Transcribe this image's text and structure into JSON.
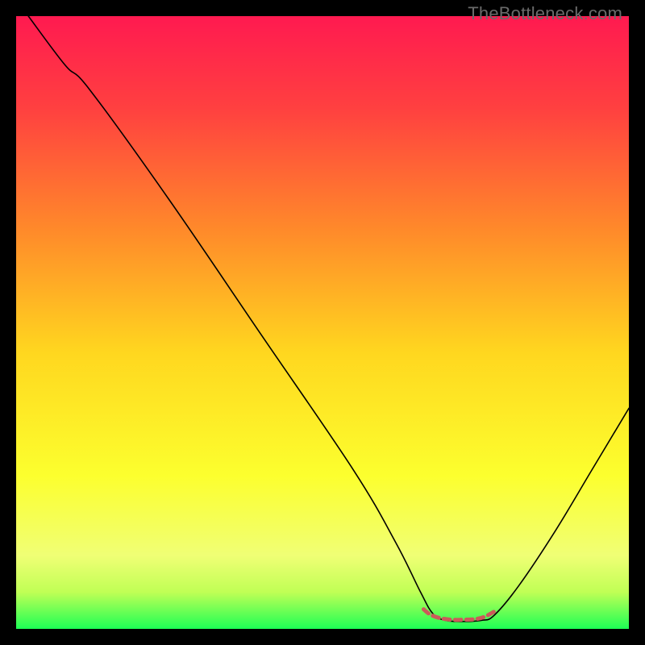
{
  "watermark": "TheBottleneck.com",
  "chart_data": {
    "type": "line",
    "title": "",
    "xlabel": "",
    "ylabel": "",
    "xlim": [
      0,
      100
    ],
    "ylim": [
      0,
      100
    ],
    "gradient_stops": [
      {
        "offset": 0.0,
        "color": "#ff1a50"
      },
      {
        "offset": 0.15,
        "color": "#ff4040"
      },
      {
        "offset": 0.35,
        "color": "#ff8a2a"
      },
      {
        "offset": 0.55,
        "color": "#ffd71f"
      },
      {
        "offset": 0.75,
        "color": "#fcff2e"
      },
      {
        "offset": 0.88,
        "color": "#f0ff75"
      },
      {
        "offset": 0.94,
        "color": "#c0ff55"
      },
      {
        "offset": 1.0,
        "color": "#1dff55"
      }
    ],
    "series": [
      {
        "name": "bottleneck-curve",
        "stroke": "#000000",
        "stroke_width": 1.6,
        "points": [
          {
            "x": 2.0,
            "y": 100.0
          },
          {
            "x": 8.0,
            "y": 92.0
          },
          {
            "x": 12.0,
            "y": 88.0
          },
          {
            "x": 25.0,
            "y": 70.0
          },
          {
            "x": 40.0,
            "y": 48.0
          },
          {
            "x": 55.0,
            "y": 26.0
          },
          {
            "x": 62.0,
            "y": 14.0
          },
          {
            "x": 66.0,
            "y": 6.0
          },
          {
            "x": 68.0,
            "y": 2.5
          },
          {
            "x": 70.0,
            "y": 1.4
          },
          {
            "x": 73.0,
            "y": 1.2
          },
          {
            "x": 76.0,
            "y": 1.4
          },
          {
            "x": 78.0,
            "y": 2.2
          },
          {
            "x": 82.0,
            "y": 7.0
          },
          {
            "x": 88.0,
            "y": 16.0
          },
          {
            "x": 94.0,
            "y": 26.0
          },
          {
            "x": 100.0,
            "y": 36.0
          }
        ]
      },
      {
        "name": "optimal-zone-marker",
        "stroke": "#cc5a5a",
        "stroke_width": 5.0,
        "dash": "8 6",
        "points": [
          {
            "x": 66.5,
            "y": 3.2
          },
          {
            "x": 67.5,
            "y": 2.4
          },
          {
            "x": 69.0,
            "y": 1.8
          },
          {
            "x": 71.0,
            "y": 1.5
          },
          {
            "x": 73.0,
            "y": 1.5
          },
          {
            "x": 75.0,
            "y": 1.6
          },
          {
            "x": 76.5,
            "y": 2.0
          },
          {
            "x": 78.0,
            "y": 2.8
          }
        ]
      }
    ]
  }
}
